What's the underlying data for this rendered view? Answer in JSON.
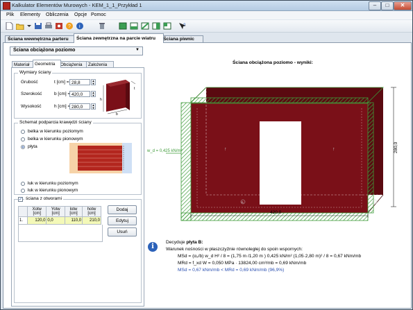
{
  "window": {
    "title": "Kalkulator Elementów Murowych - KEM_1_1_Przykład 1",
    "minimize": "–",
    "maximize": "□",
    "close": "✕"
  },
  "menu": [
    "Plik",
    "Elementy",
    "Obliczenia",
    "Opcje",
    "Pomoc"
  ],
  "toolbar_icons": [
    "new-document-icon",
    "open-folder-icon",
    "save-disk-icon",
    "print-icon",
    "settings-icon",
    "help-icon",
    "info-icon",
    "trash-icon",
    "view-icon",
    "view-icon-2",
    "view-icon-3",
    "view-icon-4",
    "view-icon-5",
    "context-help-icon"
  ],
  "main_tabs": [
    "Ściana wewnętrzna parteru",
    "Ściana zewnętrzna na parcie wiatru",
    "Ściana piwnic"
  ],
  "active_main_tab": 1,
  "element_select": "Ściana obciążona poziomo",
  "sub_tabs": [
    "Materiał",
    "Geometria",
    "Obciążenia",
    "Założenia"
  ],
  "active_sub_tab": 1,
  "wall_dims": {
    "title": "Wymiary ściany",
    "rows": [
      {
        "label": "Grubość",
        "param": "t [cm] =",
        "value": "28,8"
      },
      {
        "label": "Szerokość",
        "param": "b [cm] =",
        "value": "420,0"
      },
      {
        "label": "Wysokość",
        "param": "h [cm] =",
        "value": "280,0"
      }
    ],
    "fig_labels": {
      "h": "h",
      "b": "b",
      "t": "t"
    }
  },
  "support_scheme": {
    "title": "Schemat podparcia krawędzi ściany",
    "options": [
      {
        "label": "belka w kierunku poziomym",
        "selected": false
      },
      {
        "label": "belka w kierunku pionowym",
        "selected": false
      },
      {
        "label": "płyta",
        "selected": true
      },
      {
        "label": "łuk w kierunku poziomym",
        "selected": false
      },
      {
        "label": "łuk w kierunku pionowym",
        "selected": false
      }
    ]
  },
  "openings": {
    "checkbox_label": "ściana z otworami",
    "checked": true,
    "headers": [
      "Xotw [cm]",
      "Yotw [cm]",
      "lotw [cm]",
      "hotw [cm]"
    ],
    "rows": [
      {
        "idx": "1.",
        "values": [
          "120,0",
          "0,0",
          "110,0",
          "210,0"
        ]
      }
    ],
    "buttons": [
      "Dodaj",
      "Edytuj",
      "Usuń"
    ]
  },
  "results": {
    "title": "Ściana obciążona poziomo - wyniki:",
    "load_label": "w_d = 0,425 kN/m²",
    "dim_width": "420,0",
    "dim_height": "280,0",
    "decision_prefix": "Decyduje ",
    "decision_value": "płyta B:",
    "condition": "Warunek nośności w płaszczyźnie równoległej do spoin wspornych:",
    "line_msd": "MSd = (α₂/b) w_d H² / 8 = (1,75 m /1,20 m ) 0,425 kN/m² (1,05·2,80 m)² / 8 = 0,67 kNm/mb",
    "line_mrd": "MRd = f_xd W = 0,050 MPa · 13824,00 cm³/mb = 0,69 kNm/mb",
    "line_compare": "MSd = 0,67 kNm/mb  <  MRd = 0,69 kNm/mb     (96,9%)"
  },
  "colors": {
    "wall": "#7a1018",
    "wall_dark": "#5a0a10",
    "support_hatch": "#3f9b3a",
    "accent_blue": "#2a4fb0"
  }
}
